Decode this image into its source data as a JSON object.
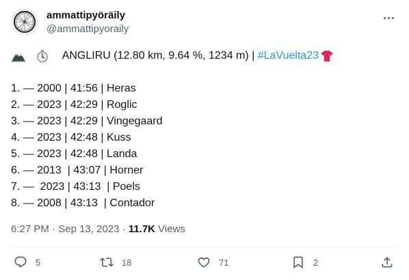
{
  "author": {
    "display_name": "ammattipyöräily",
    "handle": "@ammattipyoraily",
    "avatar_icon": "bicycle-wheel-icon"
  },
  "tweet": {
    "title_prefix_icons": [
      "mountain-emoji-icon",
      "stopwatch-emoji-icon"
    ],
    "title_text": " ANGLIRU (12.80 km, 9.64 %, 1234 m) | ",
    "hashtag": "#LaVuelta23",
    "title_suffix_icon": "red-jersey-emoji-icon",
    "results": [
      "1. — 2000 | 41:56 | Heras",
      "2. — 2023 | 42:29 | Roglic",
      "3. — 2023 | 42:29 | Vingegaard",
      "4. — 2023 | 42:48 | Kuss",
      "5. — 2023 | 42:48 | Landa",
      "6. — 2013  | 43:07 | Horner",
      "7. —  2023 | 43:13  | Poels",
      "8. — 2008 | 43:13  | Contador"
    ]
  },
  "meta": {
    "time": "6:27 PM",
    "separator": " · ",
    "date": "Sep 13, 2023",
    "views_count": "11.7K",
    "views_label": " Views"
  },
  "actions": {
    "replies": "5",
    "retweets": "18",
    "likes": "71",
    "bookmarks": "2"
  },
  "colors": {
    "link": "#1d9bf0",
    "secondary_text": "#536471",
    "primary_text": "#0f1419",
    "jersey": "#e0245e"
  }
}
